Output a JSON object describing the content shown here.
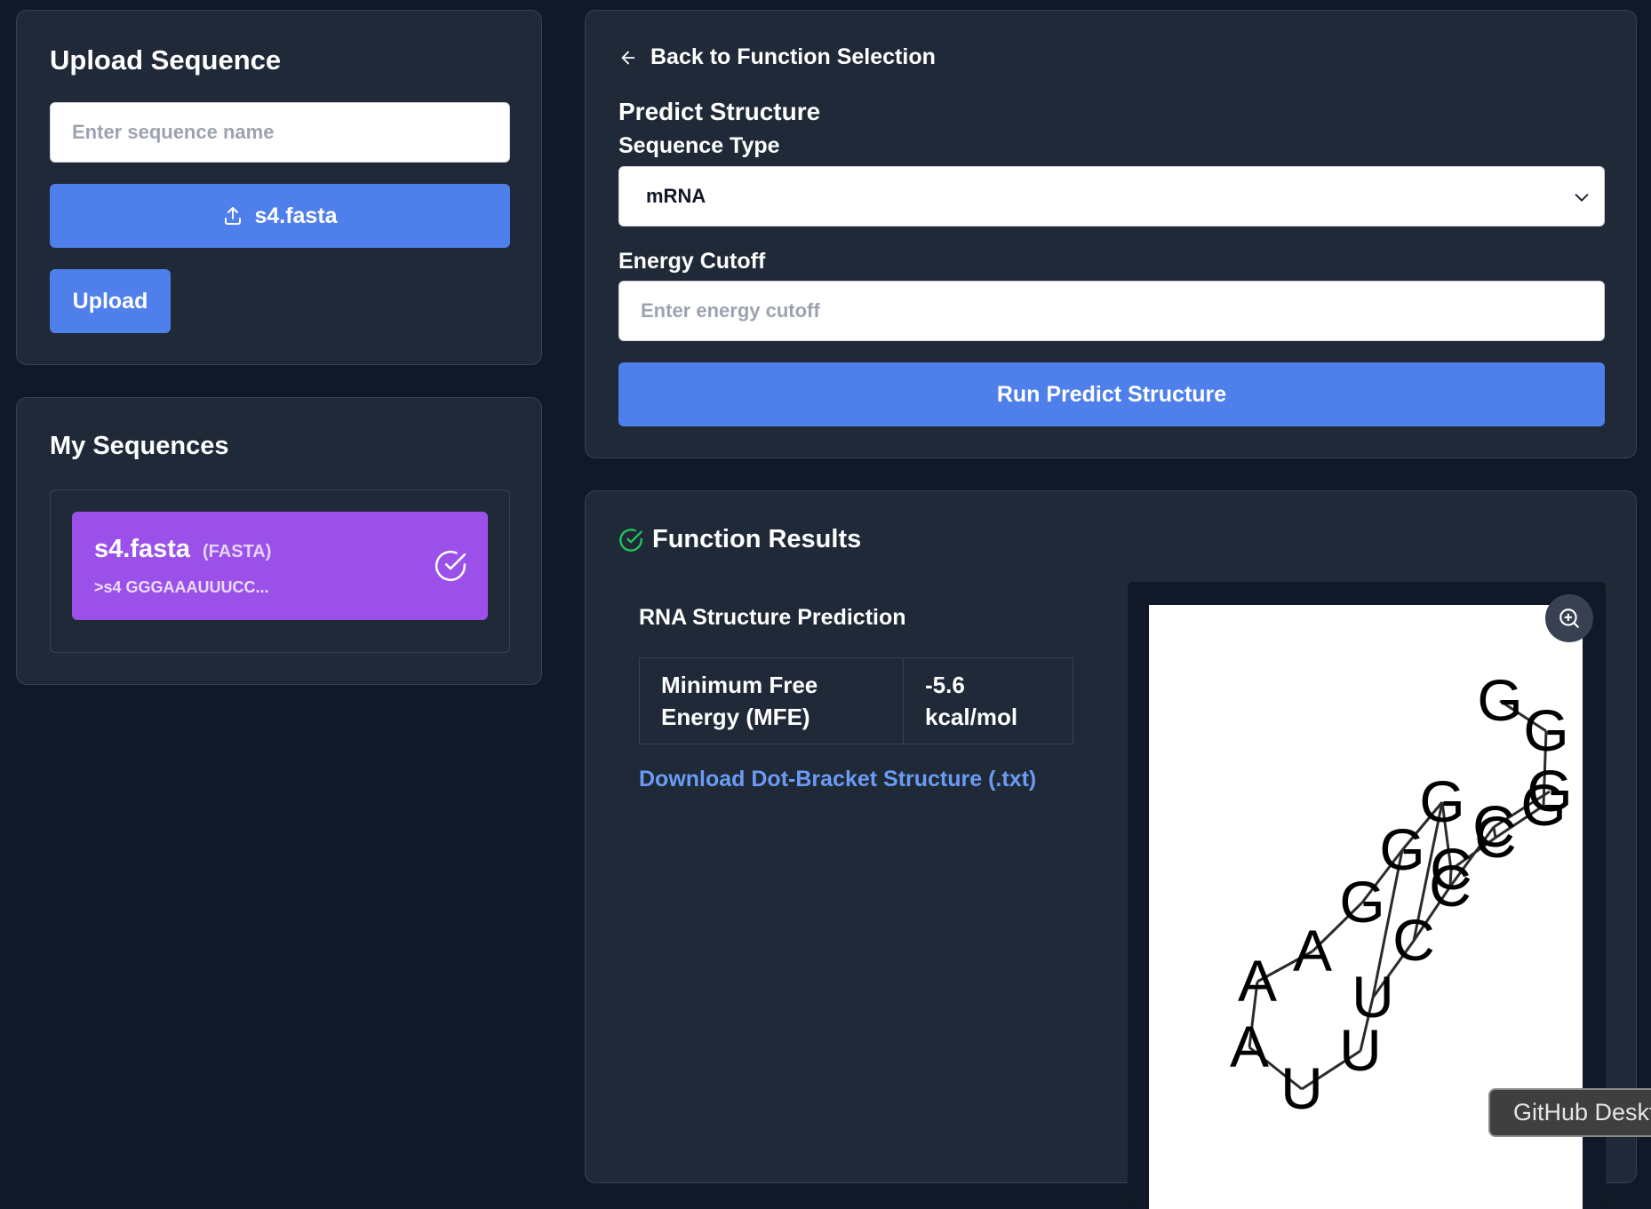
{
  "upload": {
    "title": "Upload Sequence",
    "name_placeholder": "Enter sequence name",
    "file_label": "s4.fasta",
    "upload_button": "Upload"
  },
  "sequences": {
    "title": "My Sequences",
    "items": [
      {
        "name": "s4.fasta",
        "format": "(FASTA)",
        "preview": ">s4 GGGAAAUUUCC..."
      }
    ]
  },
  "function": {
    "back_link": "Back to Function Selection",
    "title": "Predict Structure",
    "seq_type_label": "Sequence Type",
    "seq_type_value": "mRNA",
    "energy_label": "Energy Cutoff",
    "energy_placeholder": "Enter energy cutoff",
    "run_button": "Run Predict Structure"
  },
  "results": {
    "title": "Function Results",
    "subtitle": "RNA Structure Prediction",
    "mfe_label_line1": "Minimum Free",
    "mfe_label_line2": "Energy (MFE)",
    "mfe_value_line1": "-5.6",
    "mfe_value_line2": "kcal/mol",
    "download_link": "Download Dot-Bracket Structure (.txt)"
  },
  "structure_nucleotides": [
    "G",
    "G",
    "G",
    "C",
    "C",
    "G",
    "G",
    "G",
    "A",
    "A",
    "A",
    "U",
    "U",
    "U",
    "C",
    "C",
    "C",
    "G"
  ],
  "tooltip": {
    "text": "GitHub Desktop"
  },
  "colors": {
    "page_bg": "#111827",
    "panel_bg": "#1f2937",
    "primary": "#4f7fea",
    "sequence_card": "#9b51e9",
    "link": "#6b9bf2",
    "success": "#22c55e"
  }
}
